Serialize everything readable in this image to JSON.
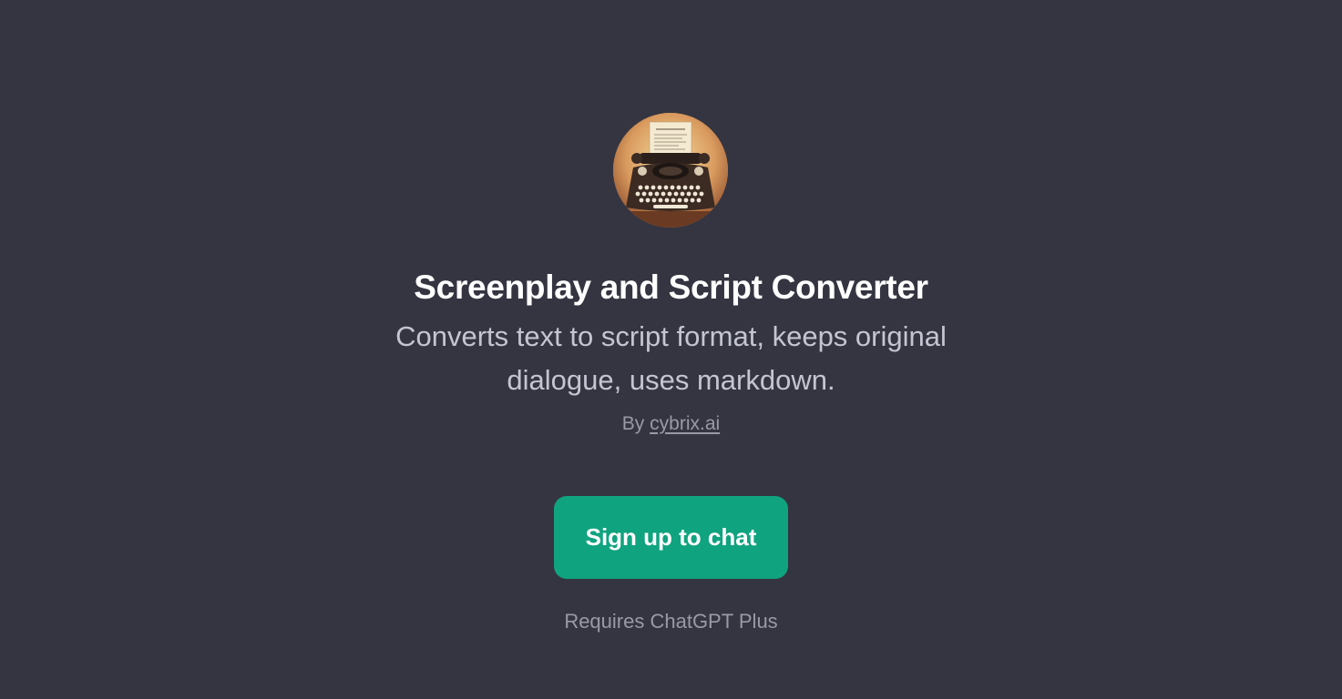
{
  "gpt": {
    "avatar_icon": "typewriter-icon",
    "title": "Screenplay and Script Converter",
    "description": "Converts text to script format, keeps original dialogue, uses markdown.",
    "byline_prefix": "By",
    "author": "cybrix.ai"
  },
  "cta": {
    "signup_label": "Sign up to chat",
    "requirement": "Requires ChatGPT Plus"
  },
  "colors": {
    "background": "#343541",
    "button": "#10a37f",
    "title": "#ffffff",
    "description": "#c5c5d2",
    "muted": "#9a9aa6"
  }
}
